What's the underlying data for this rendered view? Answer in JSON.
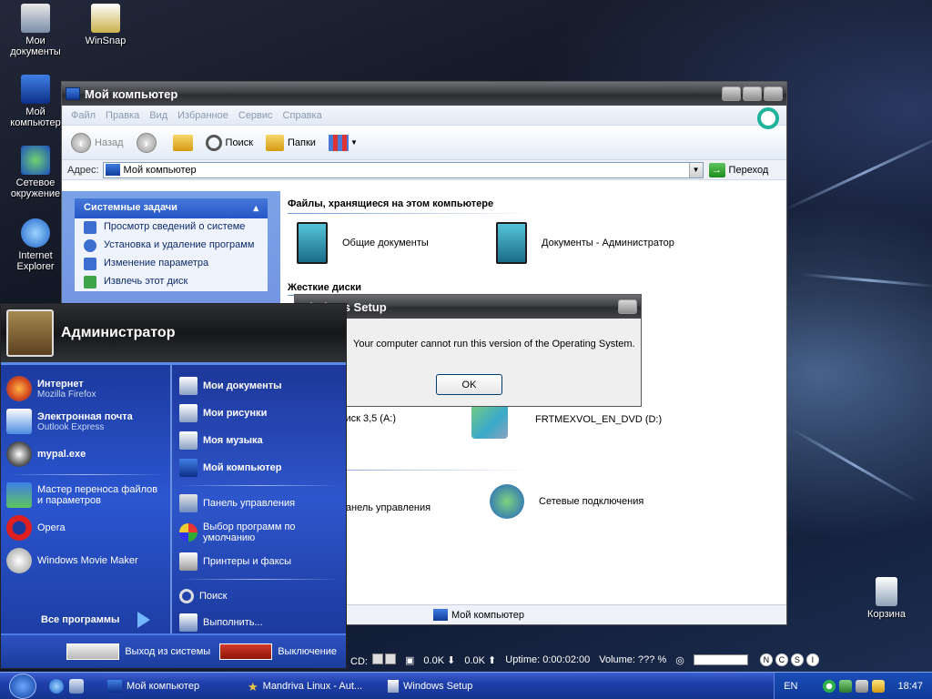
{
  "desktop": {
    "icons": [
      {
        "label": "Мои документы"
      },
      {
        "label": "WinSnap"
      },
      {
        "label": "Мой компьютер"
      },
      {
        "label": "Сетевое окружение"
      },
      {
        "label": "Internet Explorer"
      },
      {
        "label": "Корзина"
      }
    ]
  },
  "explorer": {
    "title": "Мой компьютер",
    "menu": [
      "Файл",
      "Правка",
      "Вид",
      "Избранное",
      "Сервис",
      "Справка"
    ],
    "toolbar": {
      "back": "Назад",
      "search": "Поиск",
      "folders": "Папки"
    },
    "address": {
      "label": "Адрес:",
      "value": "Мой компьютер",
      "go": "Переход"
    },
    "tasks": {
      "title": "Системные задачи",
      "items": [
        {
          "label": "Просмотр сведений о системе"
        },
        {
          "label": "Установка и удаление программ"
        },
        {
          "label": "Изменение параметра"
        },
        {
          "label": "Извлечь этот диск"
        }
      ]
    },
    "sections": {
      "stored_files": "Файлы, хранящиеся на этом компьютере",
      "hard_disks": "Жесткие диски"
    },
    "items": {
      "shared_docs": "Общие документы",
      "admin_docs": "Документы - Администратор",
      "floppy": "Диск 3,5 (A:)",
      "dvd": "FRTMEXVOL_EN_DVD (D:)",
      "control_panel": "Панель управления",
      "network": "Сетевые подключения"
    },
    "status": "Мой компьютер"
  },
  "dialog": {
    "title": "Windows Setup",
    "message": "Your computer cannot run this version of the Operating System.",
    "ok": "OK"
  },
  "start_menu": {
    "user": "Администратор",
    "left": [
      {
        "title": "Интернет",
        "sub": "Mozilla Firefox"
      },
      {
        "title": "Электронная почта",
        "sub": "Outlook Express"
      },
      {
        "title": "mypal.exe",
        "sub": ""
      },
      {
        "title": "Мастер переноса файлов и параметров",
        "sub": ""
      },
      {
        "title": "Opera",
        "sub": ""
      },
      {
        "title": "Windows Movie Maker",
        "sub": ""
      }
    ],
    "all_programs": "Все программы",
    "right": [
      {
        "label": "Мои документы"
      },
      {
        "label": "Мои рисунки"
      },
      {
        "label": "Моя музыка"
      },
      {
        "label": "Мой компьютер"
      },
      {
        "label": "Панель управления"
      },
      {
        "label": "Выбор программ по умолчанию"
      },
      {
        "label": "Принтеры и факсы"
      },
      {
        "label": "Поиск"
      },
      {
        "label": "Выполнить..."
      }
    ],
    "logoff": "Выход из системы",
    "shutdown": "Выключение"
  },
  "monitor": {
    "cd_label": "CD:",
    "down": "0.0K",
    "up": "0.0K",
    "uptime_label": "Uptime:",
    "uptime": "0:00:02:00",
    "volume_label": "Volume:",
    "volume": "???",
    "volume_unit": "%",
    "buttons": [
      "N",
      "C",
      "S",
      "I"
    ]
  },
  "taskbar": {
    "tasks": [
      {
        "label": "Мой компьютер"
      },
      {
        "label": "Mandriva Linux - Aut..."
      },
      {
        "label": "Windows Setup"
      }
    ],
    "lang": "EN",
    "time": "18:47"
  },
  "colors": {
    "xp_blue": "#2456c8",
    "start_menu_blue": "#2b56d1",
    "taskbar_blue": "#1e3faa"
  }
}
